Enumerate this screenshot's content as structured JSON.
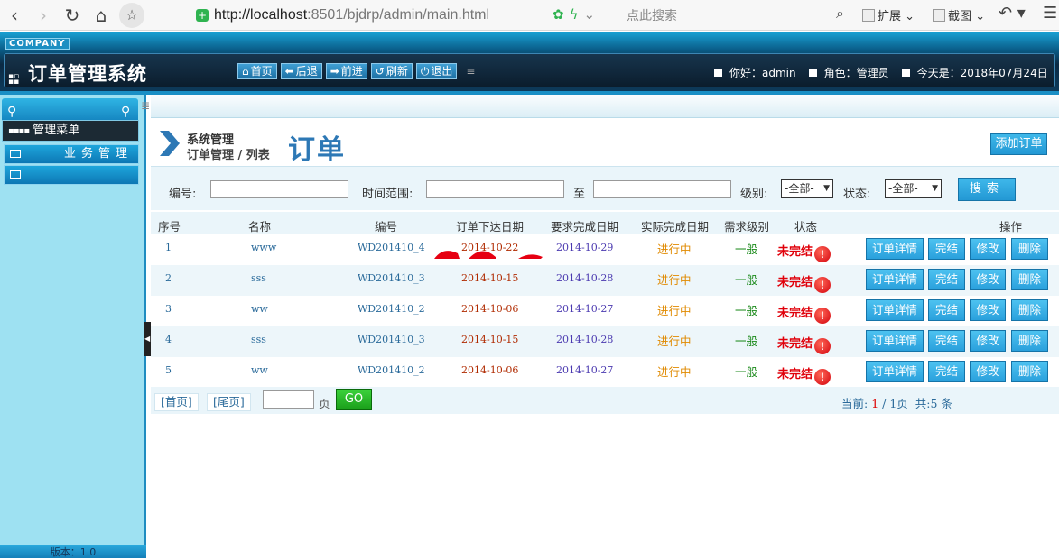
{
  "browser": {
    "url_host": "http://localhost",
    "url_rest": ":8501/bjdrp/admin/main.html",
    "search_placeholder": "点此搜索",
    "ext_label": "扩展",
    "screenshot_label": "截图"
  },
  "header": {
    "company": "COMPANY",
    "title": "订单管理系统",
    "toolbar": {
      "home": "首页",
      "back": "后退",
      "forward": "前进",
      "refresh": "刷新",
      "logout": "退出"
    },
    "greeting": "你好：admin",
    "role": "角色：管理员",
    "today": "今天是：2018年07月24日"
  },
  "sidebar": {
    "menu_title": "管理菜单",
    "items": [
      {
        "label": "业务管理"
      },
      {
        "label": ""
      }
    ],
    "version": "版本：1.0"
  },
  "main": {
    "crumb_top": "系统管理",
    "crumb_bottom": "订单管理 / 列表",
    "title": "订单",
    "add_label": "添加订单"
  },
  "filters": {
    "code_label": "编号:",
    "time_label": "时间范围:",
    "to_label": "至",
    "level_label": "级别:",
    "level_value": "-全部-",
    "status_label": "状态:",
    "status_value": "-全部-",
    "search_label": "搜索"
  },
  "table": {
    "headers": [
      "序号",
      "名称",
      "编号",
      "订单下达日期",
      "要求完成日期",
      "实际完成日期",
      "需求级别",
      "状态",
      "操作"
    ],
    "actions": {
      "detail": "订单详情",
      "finish": "完结",
      "edit": "修改",
      "delete": "删除"
    },
    "rows": [
      {
        "no": "1",
        "name": "www",
        "code": "WD201410_4",
        "order_date": "2014-10-22",
        "due_date": "2014-10-29",
        "actual": "进行中",
        "level": "一般",
        "status": "未完结"
      },
      {
        "no": "2",
        "name": "sss",
        "code": "WD201410_3",
        "order_date": "2014-10-15",
        "due_date": "2014-10-28",
        "actual": "进行中",
        "level": "一般",
        "status": "未完结"
      },
      {
        "no": "3",
        "name": "ww",
        "code": "WD201410_2",
        "order_date": "2014-10-06",
        "due_date": "2014-10-27",
        "actual": "进行中",
        "level": "一般",
        "status": "未完结"
      },
      {
        "no": "4",
        "name": "sss",
        "code": "WD201410_3",
        "order_date": "2014-10-15",
        "due_date": "2014-10-28",
        "actual": "进行中",
        "level": "一般",
        "status": "未完结"
      },
      {
        "no": "5",
        "name": "ww",
        "code": "WD201410_2",
        "order_date": "2014-10-06",
        "due_date": "2014-10-27",
        "actual": "进行中",
        "level": "一般",
        "status": "未完结"
      }
    ]
  },
  "pager": {
    "first": "[首页]",
    "last": "[尾页]",
    "page_unit": "页",
    "go": "GO",
    "current_prefix": "当前:",
    "current_page": "1",
    "total_pages": "/ 1页",
    "total_count": "共:5 条"
  }
}
